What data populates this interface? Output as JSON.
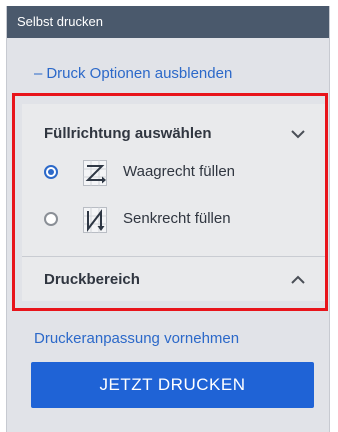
{
  "header": {
    "title": "Selbst drucken"
  },
  "options_toggle": {
    "symbol": "–",
    "label": "Druck Optionen ausblenden"
  },
  "fill_direction": {
    "title": "Füllrichtung auswählen",
    "chevron_icon": "chevron-down-icon",
    "options": [
      {
        "label": "Waagrecht füllen",
        "icon": "horizontal-fill-icon",
        "checked": true
      },
      {
        "label": "Senkrecht füllen",
        "icon": "vertical-fill-icon",
        "checked": false
      }
    ]
  },
  "print_area": {
    "title": "Druckbereich",
    "chevron_icon": "chevron-up-icon"
  },
  "printer_adjust": {
    "label": "Druckeranpassung vornehmen"
  },
  "print_button": {
    "label": "JETZT DRUCKEN"
  },
  "colors": {
    "header_bg": "#4a596c",
    "link": "#2c69c9",
    "button_bg": "#1f63d6",
    "highlight_frame": "#e8141b",
    "panel_bg": "#e1e3e8"
  }
}
